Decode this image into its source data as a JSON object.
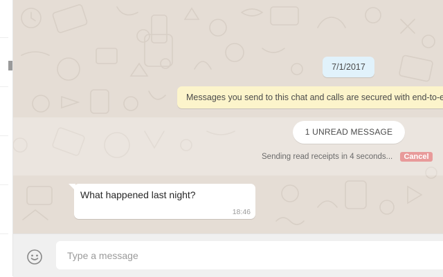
{
  "chat": {
    "date_chip": "7/1/2017",
    "encryption_notice": "Messages you send to this chat and calls are secured with end-to-end encryption.",
    "unread_label": "1 UNREAD MESSAGE",
    "receipts_text": "Sending read receipts in 4 seconds...",
    "cancel_label": "Cancel",
    "messages": [
      {
        "text": "What happened last night?",
        "time": "18:46",
        "direction": "incoming"
      }
    ]
  },
  "compose": {
    "placeholder": "Type a message",
    "emoji_icon": "smiley-icon"
  },
  "colors": {
    "chat_bg": "#e5ddd5",
    "date_chip_bg": "#e1f2fb",
    "encryption_bg": "#fcf4cb",
    "cancel_bg": "#e89a9a",
    "compose_bg": "#f0f0f0"
  }
}
